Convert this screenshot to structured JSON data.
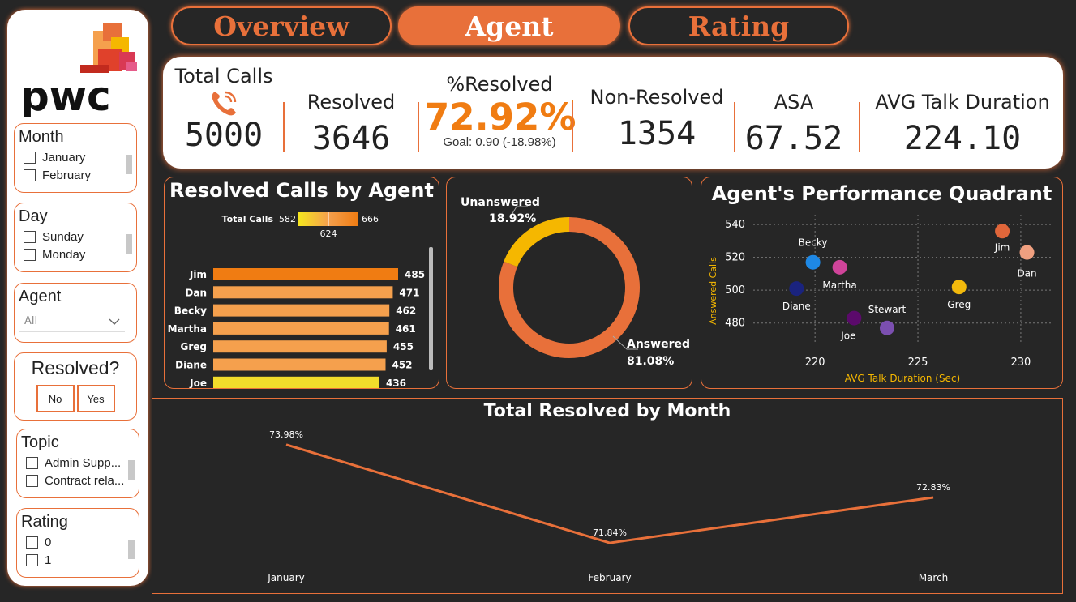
{
  "colors": {
    "accent": "#e8703a",
    "bg": "#262626",
    "answered": "#e8703a",
    "unanswered": "#f5b700"
  },
  "brand": {
    "logo_text": "pwc"
  },
  "tabs": [
    {
      "label": "Overview",
      "active": false
    },
    {
      "label": "Agent",
      "active": true
    },
    {
      "label": "Rating",
      "active": false
    }
  ],
  "slicers": {
    "month": {
      "title": "Month",
      "items": [
        "January",
        "February"
      ]
    },
    "day": {
      "title": "Day",
      "items": [
        "Sunday",
        "Monday"
      ]
    },
    "agent": {
      "title": "Agent",
      "selected": "All"
    },
    "resolved": {
      "title": "Resolved?",
      "no": "No",
      "yes": "Yes"
    },
    "topic": {
      "title": "Topic",
      "items": [
        "Admin Supp...",
        "Contract rela..."
      ]
    },
    "rating": {
      "title": "Rating",
      "items": [
        "0",
        "1"
      ]
    }
  },
  "kpis": {
    "total_calls": {
      "title": "Total Calls",
      "value": "5000"
    },
    "resolved": {
      "title": "Resolved",
      "value": "3646"
    },
    "pct_resolved": {
      "title": "%Resolved",
      "value": "72.92%",
      "flag": "!",
      "goal": "Goal: 0.90 (-18.98%)"
    },
    "non_resolved": {
      "title": "Non-Resolved",
      "value": "1354"
    },
    "asa": {
      "title": "ASA",
      "value": "67.52"
    },
    "avg_talk": {
      "title": "AVG Talk Duration",
      "value": "224.10"
    }
  },
  "chart_data": [
    {
      "id": "resolved_by_agent",
      "type": "bar",
      "orientation": "horizontal",
      "title": "Resolved Calls by Agent",
      "legend": {
        "title": "Total Calls",
        "min": "582",
        "max": "666",
        "mid": "624"
      },
      "categories": [
        "Jim",
        "Dan",
        "Becky",
        "Martha",
        "Greg",
        "Diane",
        "Joe"
      ],
      "values": [
        485,
        471,
        462,
        461,
        455,
        452,
        436
      ],
      "colors": [
        "#f07c12",
        "#f5a04d",
        "#f5a04d",
        "#f5a04d",
        "#f5a04d",
        "#f5a04d",
        "#f2dc2b"
      ]
    },
    {
      "id": "answered_donut",
      "type": "pie",
      "donut": true,
      "slices": [
        {
          "name": "Answered",
          "value": 81.08,
          "label": "81.08%"
        },
        {
          "name": "Unanswered",
          "value": 18.92,
          "label": "18.92%"
        }
      ]
    },
    {
      "id": "performance_quadrant",
      "type": "scatter",
      "title": "Agent's Performance Quadrant",
      "xlabel": "AVG Talk Duration (Sec)",
      "ylabel": "Answered Calls",
      "xlim": [
        217,
        231.5
      ],
      "ylim": [
        468,
        546
      ],
      "xticks": [
        220,
        225,
        230
      ],
      "yticks": [
        480,
        500,
        520,
        540
      ],
      "grid": true,
      "points": [
        {
          "name": "Jim",
          "x": 229.1,
          "y": 536,
          "color": "#e0663a"
        },
        {
          "name": "Dan",
          "x": 230.3,
          "y": 523,
          "color": "#f0a080"
        },
        {
          "name": "Becky",
          "x": 219.9,
          "y": 517,
          "color": "#1e88e5"
        },
        {
          "name": "Martha",
          "x": 221.2,
          "y": 514,
          "color": "#d0449a"
        },
        {
          "name": "Diane",
          "x": 219.1,
          "y": 501,
          "color": "#1a237e"
        },
        {
          "name": "Greg",
          "x": 227.0,
          "y": 502,
          "color": "#f2b90c"
        },
        {
          "name": "Joe",
          "x": 221.9,
          "y": 483,
          "color": "#5b0a6b"
        },
        {
          "name": "Stewart",
          "x": 223.5,
          "y": 477,
          "color": "#7b4fb0"
        }
      ]
    },
    {
      "id": "resolved_by_month",
      "type": "line",
      "title": "Total Resolved by Month",
      "categories": [
        "January",
        "February",
        "March"
      ],
      "values": [
        73.98,
        71.84,
        72.83
      ],
      "labels": [
        "73.98%",
        "71.84%",
        "72.83%"
      ],
      "ylim": [
        71.7,
        74.1
      ]
    }
  ]
}
